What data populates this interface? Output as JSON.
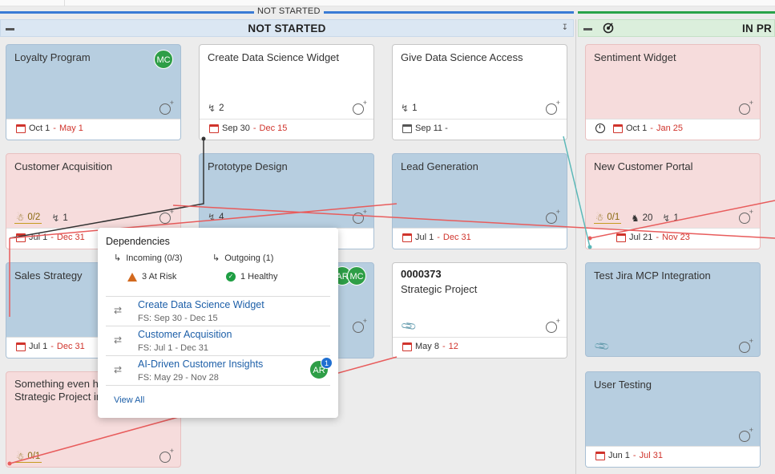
{
  "groups": [
    {
      "title": "NOT STARTED",
      "color": "#3a7bd5"
    },
    {
      "title": "",
      "color": "#2aa34a"
    }
  ],
  "columns": [
    {
      "title": "NOT STARTED"
    },
    {
      "title": "IN PR"
    }
  ],
  "cards": {
    "loyalty": {
      "title": "Loyalty Program",
      "avatar": "MC",
      "date_start": "Oct 1",
      "date_end": "May 1"
    },
    "create_ds": {
      "title": "Create Data Science Widget",
      "links": "2",
      "date_start": "Sep 30",
      "date_end": "Dec 15"
    },
    "give_ds": {
      "title": "Give Data Science Access",
      "links": "1",
      "date_start": "Sep 11 -",
      "date_end": ""
    },
    "sentiment": {
      "title": "Sentiment Widget",
      "date_start": "Oct 1",
      "date_end": "Jan 25"
    },
    "cust_acq": {
      "title": "Customer Acquisition",
      "warn": "0/2",
      "links": "1",
      "date_start": "Jul 1",
      "date_end": "Dec 31"
    },
    "prototype": {
      "title": "Prototype Design",
      "links": "4"
    },
    "lead_gen": {
      "title": "Lead Generation",
      "date_start": "Jul 1",
      "date_end": "Dec 31"
    },
    "new_portal": {
      "title": "New Customer Portal",
      "warn": "0/1",
      "count": "20",
      "links": "1",
      "date_start": "Jul 21",
      "date_end": "Nov 23"
    },
    "sales": {
      "title": "Sales Strategy",
      "date_start": "Jul 1",
      "date_end": "Dec 31"
    },
    "hidden_avatars": [
      "AR",
      "MC"
    ],
    "strategic": {
      "id": "0000373",
      "title": "Strategic Project",
      "date_start": "May 8",
      "date_end": "12"
    },
    "jira": {
      "title": "Test Jira MCP Integration"
    },
    "something": {
      "title": "Something even h… Strategic Project in",
      "title_line1": "Something even h",
      "title_line2": "Strategic Project in",
      "warn": "0/1"
    },
    "user_testing": {
      "title": "User Testing",
      "date_start": "Jun 1",
      "date_end": "Jul 31"
    }
  },
  "popover": {
    "title": "Dependencies",
    "incoming": "Incoming (0/3)",
    "outgoing": "Outgoing (1)",
    "at_risk": "3 At Risk",
    "healthy": "1 Healthy",
    "items": [
      {
        "name": "Create Data Science Widget",
        "sub": "FS: Sep 30 - Dec 15"
      },
      {
        "name": "Customer Acquisition",
        "sub": "FS: Jul 1 - Dec 31"
      },
      {
        "name": "AI-Driven Customer Insights",
        "sub": "FS: May 29 - Nov 28",
        "avatar": "AR",
        "badge": "1"
      }
    ],
    "view_all": "View All"
  },
  "colors": {
    "accent_link": "#1d5fa8",
    "dependency_line": "#e85c5c",
    "risk": "#d2691e",
    "healthy": "#1e9e43"
  }
}
